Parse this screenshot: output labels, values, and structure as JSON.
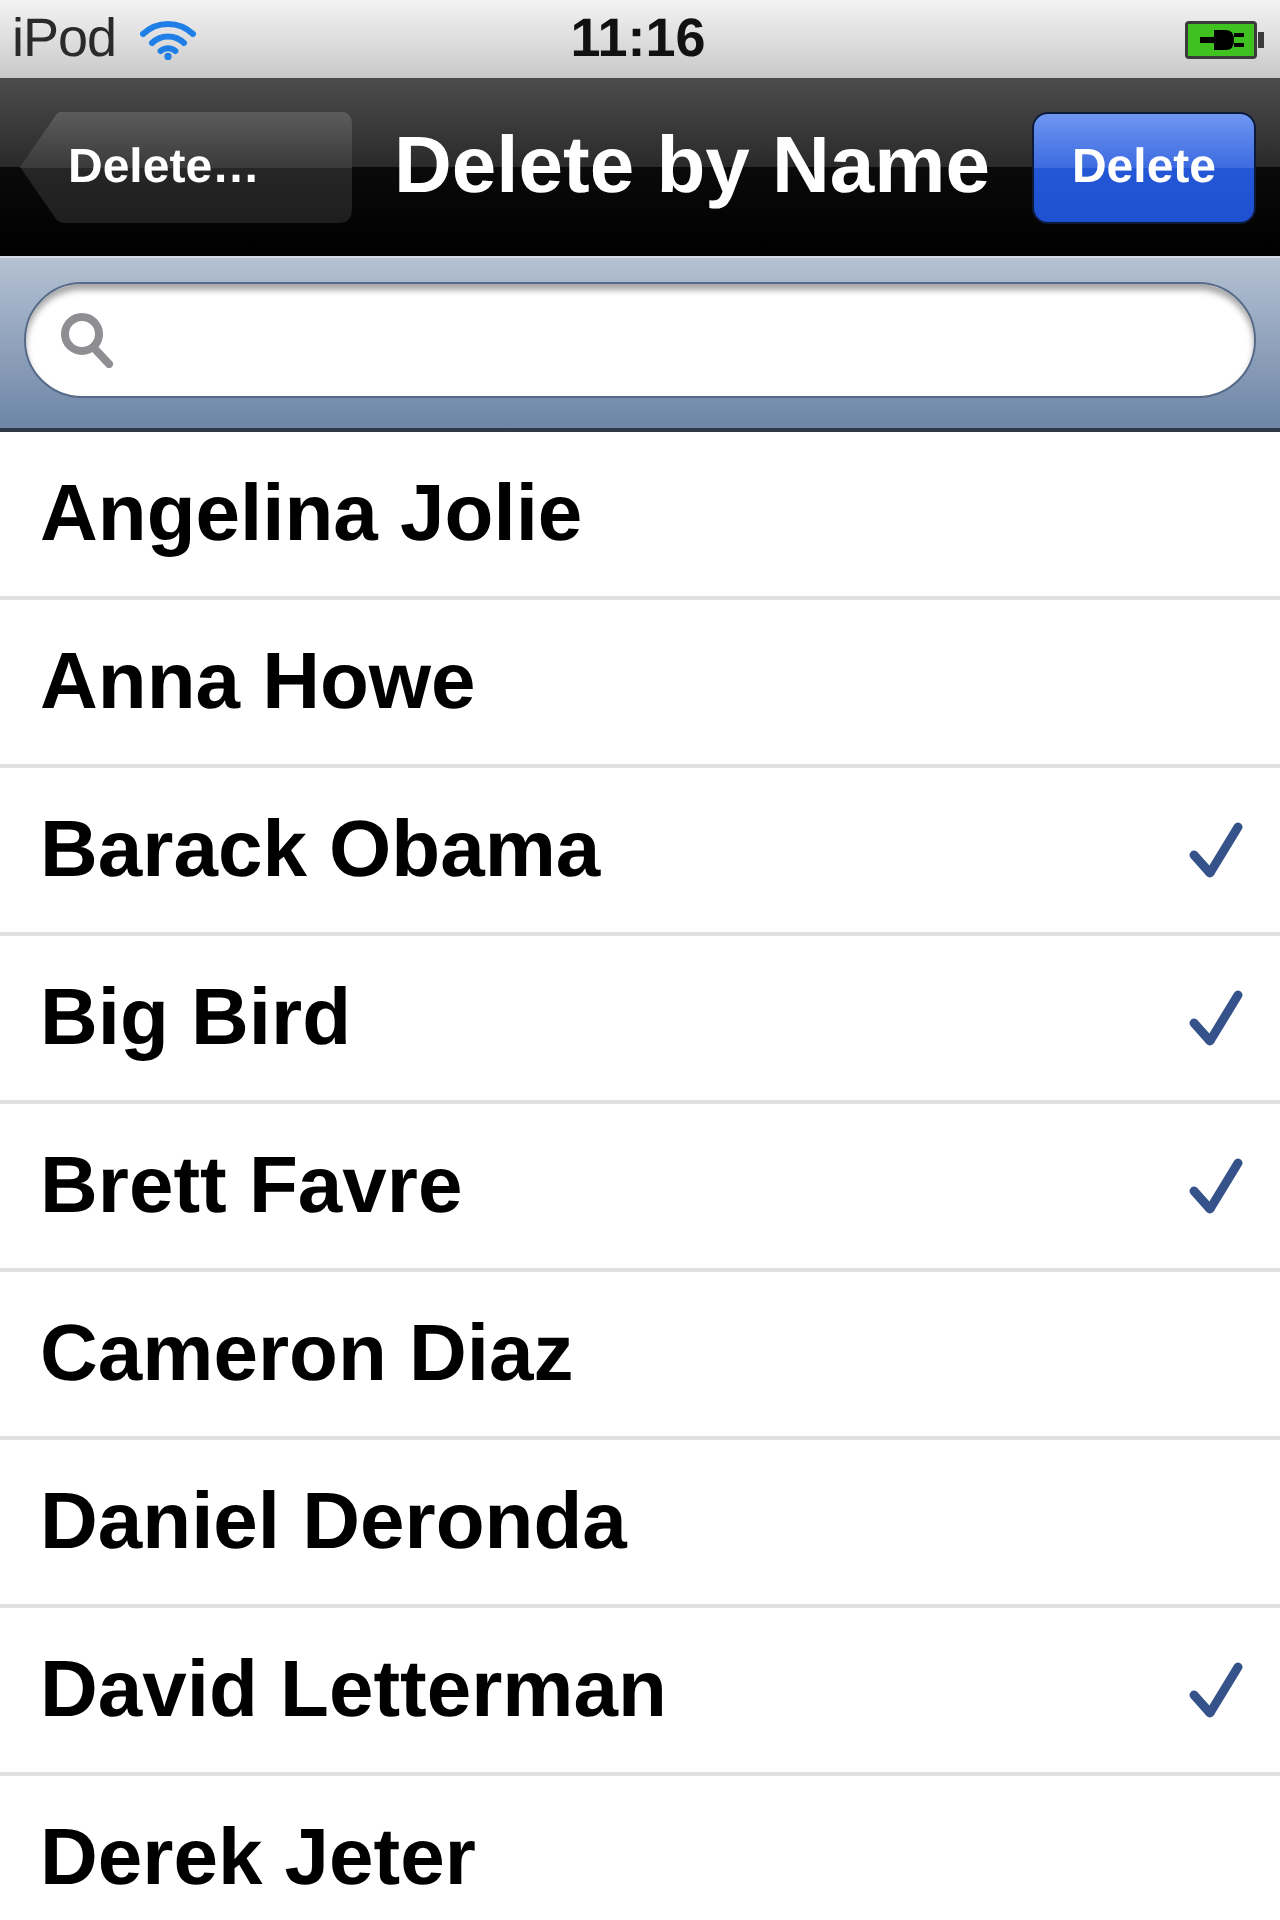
{
  "status_bar": {
    "carrier": "iPod",
    "time": "11:16"
  },
  "nav_bar": {
    "back_button": "Delete…",
    "title": "Delete by Name",
    "action_button": "Delete"
  },
  "contacts": [
    {
      "name": "Angelina Jolie",
      "checked": false
    },
    {
      "name": "Anna Howe",
      "checked": false
    },
    {
      "name": "Barack Obama",
      "checked": true
    },
    {
      "name": "Big Bird",
      "checked": true
    },
    {
      "name": "Brett Favre",
      "checked": true
    },
    {
      "name": "Cameron Diaz",
      "checked": false
    },
    {
      "name": "Daniel Deronda",
      "checked": false
    },
    {
      "name": "David Letterman",
      "checked": true
    },
    {
      "name": "Derek Jeter",
      "checked": false
    }
  ]
}
